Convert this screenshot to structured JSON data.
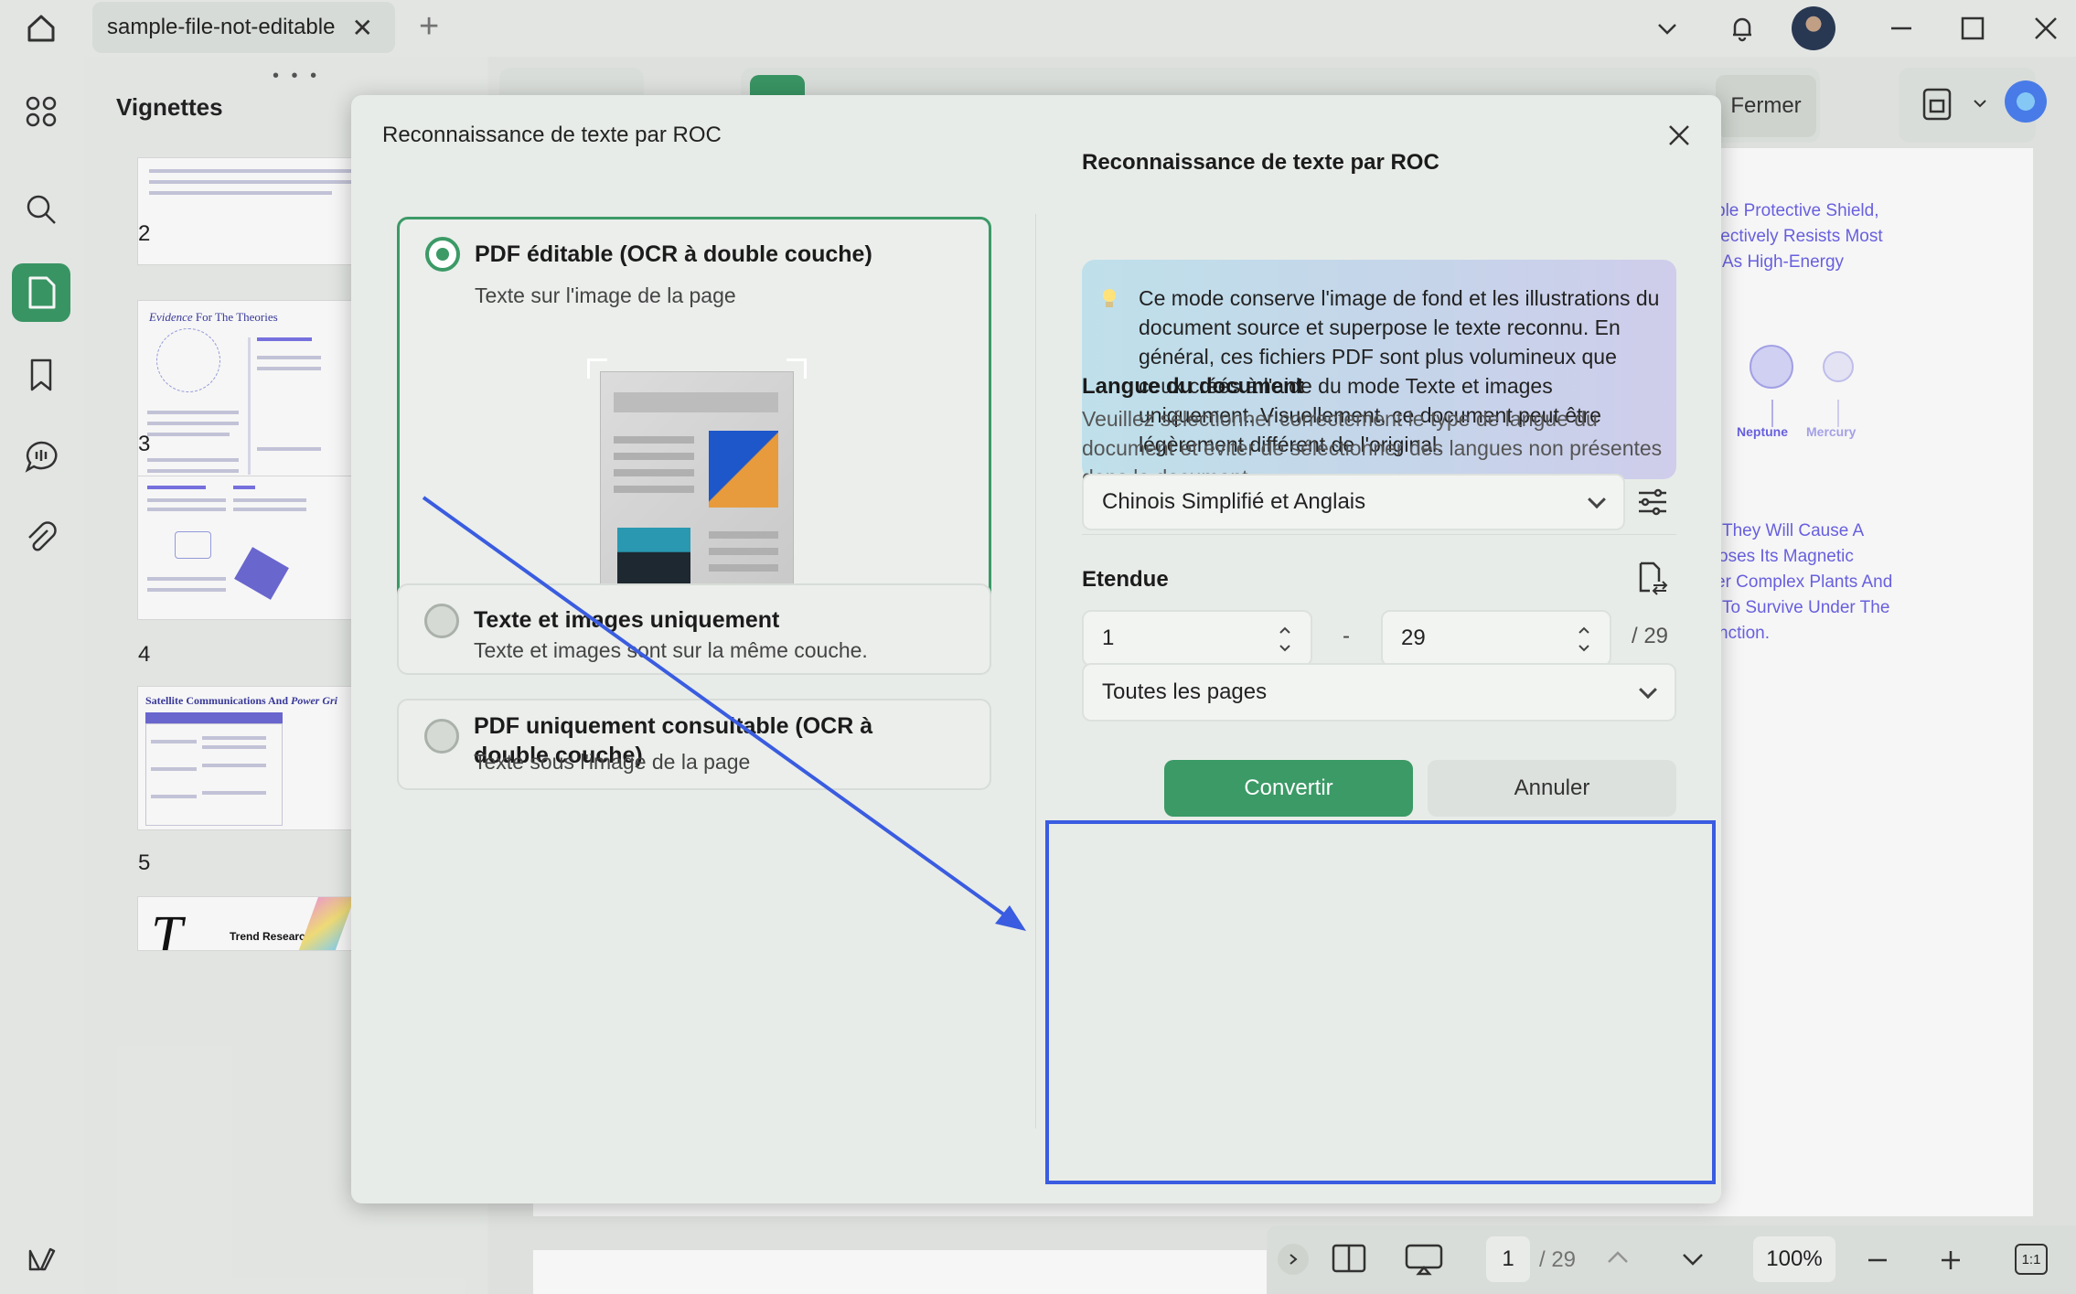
{
  "topbar": {
    "tab_title": "sample-file-not-editable",
    "close_tab": "✕",
    "new_tab": "+"
  },
  "thumbnails": {
    "title": "Vignettes",
    "pages": [
      {
        "num": "2"
      },
      {
        "num": "3",
        "heading_italic": "Evidence",
        "heading": " For The Theories"
      },
      {
        "num": "4"
      },
      {
        "num": "5",
        "heading": "Satellite Communications And ",
        "heading_italic": "Power Gri"
      }
    ],
    "last_heading": "Trend Research"
  },
  "toolbar": {
    "close_label": "Fermer"
  },
  "document_background": {
    "lines_top": [
      "ble Protective Shield,",
      "fectively Resists Most",
      "As High-Energy"
    ],
    "planets": [
      "Neptune",
      "Mercury"
    ],
    "lines_bottom": [
      "They Will Cause A",
      "oses Its Magnetic",
      "er Complex Plants And",
      "To Survive Under The",
      "nction."
    ]
  },
  "bottombar": {
    "page_current": "1",
    "page_total": "/ 29",
    "zoom": "100%",
    "fit_label": "1:1"
  },
  "modal": {
    "title": "Reconnaissance de texte par ROC",
    "options": [
      {
        "title": "PDF éditable (OCR à double couche)",
        "subtitle": "Texte sur l'image de la page",
        "selected": true
      },
      {
        "title": "Texte et images uniquement",
        "subtitle": "Texte et images sont sur la même couche.",
        "selected": false
      },
      {
        "title": "PDF uniquement consultable (OCR à double couche)",
        "subtitle": "Texte sous l'image de la page",
        "selected": false
      }
    ],
    "right": {
      "heading": "Reconnaissance de texte par ROC",
      "info": "Ce mode conserve l'image de fond et les illustrations du document source et superpose le texte reconnu. En général, ces fichiers PDF sont plus volumineux que ceux créés à l'aide du mode Texte et images uniquement. Visuellement, ce document peut être légèrement différent de l'original.",
      "language_heading": "Langue du document",
      "language_desc": "Veuillez sélectionner correctement le type de langue du document et éviter de sélectionner des langues non présentes dans le document.",
      "language_value": "Chinois Simplifié et Anglais",
      "range_heading": "Etendue",
      "range_from": "1",
      "range_dash": "-",
      "range_to": "29",
      "range_total": "/ 29",
      "range_mode": "Toutes les pages",
      "convert": "Convertir",
      "cancel": "Annuler"
    }
  },
  "colors": {
    "accent": "#3b9a66",
    "annotation": "#3a5ce0"
  }
}
